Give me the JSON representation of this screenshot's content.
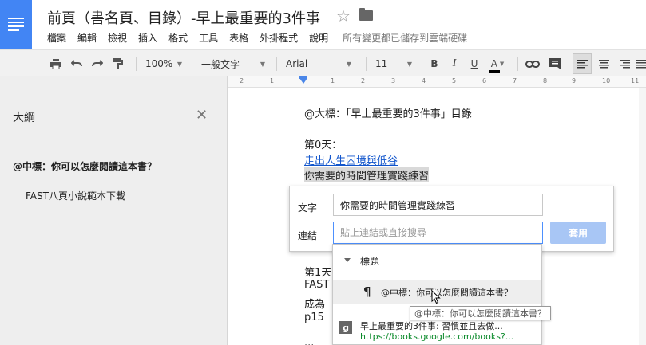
{
  "header": {
    "title": "前頁（書名頁、目錄）-早上最重要的3件事",
    "star_icon": "star-icon",
    "folder_icon": "folder-icon",
    "menus": [
      "檔案",
      "編輯",
      "檢視",
      "插入",
      "格式",
      "工具",
      "表格",
      "外掛程式",
      "說明"
    ],
    "save_status": "所有變更都已儲存到雲端硬碟"
  },
  "toolbar": {
    "zoom": "100%",
    "style": "一般文字",
    "font": "Arial",
    "size": "11",
    "bold": "B",
    "italic": "I",
    "underline": "U",
    "text_color": "A"
  },
  "ruler": {
    "numbers": [
      "2",
      "1",
      "1",
      "2",
      "3",
      "4",
      "5",
      "6",
      "7",
      "8",
      "9",
      "10",
      "11",
      "12"
    ]
  },
  "outline": {
    "title": "大綱",
    "items": [
      {
        "label": "@中標：你可以怎麼閱讀這本書？"
      },
      {
        "label": "FAST八頁小說範本下載"
      }
    ]
  },
  "doc": {
    "heading": "@大標：「早上最重要的3件事」目錄",
    "day0": "第0天：",
    "link1": "走出人生困境與低谷",
    "selected_text": "你需要的時間管理實踐練習",
    "day1": "第1天",
    "fast": "FAST",
    "become": "成為",
    "p15": "p15",
    "dots": "..."
  },
  "link_dialog": {
    "text_label": "文字",
    "text_value": "你需要的時間管理實踐練習",
    "link_label": "連結",
    "link_placeholder": "貼上連結或直接搜尋",
    "apply_label": "套用"
  },
  "suggestions": {
    "section": "標題",
    "heading_item": "@中標：你可以怎麼閱讀這本書？",
    "web_item_title": "早上最重要的3件事: 習慣並且去做...",
    "web_item_url": "https://books.google.com/books?..."
  },
  "tooltip": "@中標：你可以怎麼閱讀這本書？",
  "colors": {
    "brand_blue": "#4285f4",
    "apply_button": "#a8c6f5",
    "link_blue": "#1155cc"
  }
}
